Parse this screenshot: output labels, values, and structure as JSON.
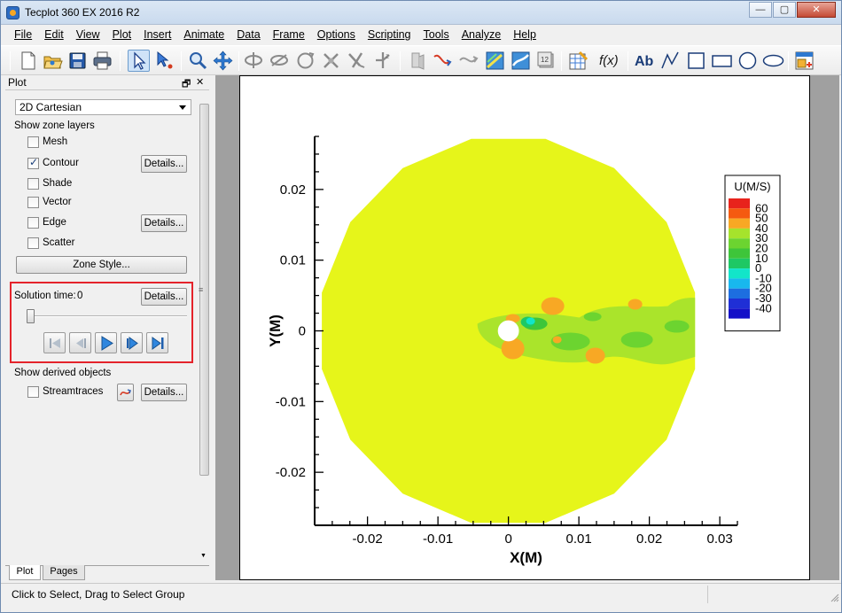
{
  "window": {
    "title": "Tecplot 360 EX 2016 R2",
    "controls": [
      "—",
      "▢",
      "✕"
    ]
  },
  "menu": [
    {
      "label": "File"
    },
    {
      "label": "Edit"
    },
    {
      "label": "View"
    },
    {
      "label": "Plot"
    },
    {
      "label": "Insert"
    },
    {
      "label": "Animate"
    },
    {
      "label": "Data"
    },
    {
      "label": "Frame"
    },
    {
      "label": "Options"
    },
    {
      "label": "Scripting"
    },
    {
      "label": "Tools"
    },
    {
      "label": "Analyze"
    },
    {
      "label": "Help"
    }
  ],
  "toolbar": {
    "icons": [
      "new-layout-icon",
      "open-icon",
      "save-icon",
      "print-icon",
      "selector-icon",
      "adjustor-icon",
      "zoom-icon",
      "translate-icon",
      "rotate-icons",
      "probe-icon",
      "slice-icon",
      "streamtrace-icon",
      "contour-level-icon",
      "isosurface-icon",
      "zone-edit-icon",
      "data-edit-icon",
      "equation-icon",
      "text-icon",
      "polyline-icon",
      "square-icon",
      "rectangle-icon",
      "circle-icon",
      "ellipse-icon",
      "frame-add-icon"
    ],
    "equation_label": "f(x)",
    "text_label": "Ab"
  },
  "sidebar": {
    "panel_title": "Plot",
    "plot_type": "2D Cartesian",
    "zone_layers_label": "Show zone layers",
    "layers": [
      {
        "label": "Mesh",
        "checked": false
      },
      {
        "label": "Contour",
        "checked": true,
        "details": "Details..."
      },
      {
        "label": "Shade",
        "checked": false
      },
      {
        "label": "Vector",
        "checked": false
      },
      {
        "label": "Edge",
        "checked": false,
        "details": "Details..."
      },
      {
        "label": "Scatter",
        "checked": false
      }
    ],
    "zone_style_button": "Zone Style...",
    "solution_time_label": "Solution time:",
    "solution_time_value": "0",
    "solution_details": "Details...",
    "derived_label": "Show derived objects",
    "streamtraces_label": "Streamtraces",
    "streamtraces_details": "Details...",
    "tabs": {
      "plot": "Plot",
      "pages": "Pages"
    }
  },
  "status": {
    "text": "Click to Select, Drag to Select Group"
  },
  "colors": {
    "background_field": "#e6f51a",
    "accent_highlight": "#e4232b"
  },
  "chart_data": {
    "type": "heatmap",
    "xlabel": "X(M)",
    "ylabel": "Y(M)",
    "xlim": [
      -0.0275,
      0.0325
    ],
    "ylim": [
      -0.0275,
      0.0275
    ],
    "x_ticks": [
      -0.02,
      -0.01,
      0,
      0.01,
      0.02,
      0.03
    ],
    "y_ticks": [
      0.02,
      0.01,
      0,
      -0.01,
      -0.02
    ],
    "x_tick_labels": [
      "-0.02",
      "-0.01",
      "0",
      "0.01",
      "0.02",
      "0.03"
    ],
    "y_tick_labels": [
      "0.02",
      "0.01",
      "0",
      "-0.01",
      "-0.02"
    ],
    "legend_title": "U(M/S)",
    "legend_placement": "right",
    "legend_levels": [
      {
        "label": "60",
        "color": "#e8231c"
      },
      {
        "label": "50",
        "color": "#f55a10"
      },
      {
        "label": "40",
        "color": "#f8a824"
      },
      {
        "label": "30",
        "color": "#a6e32c"
      },
      {
        "label": "20",
        "color": "#6cd430"
      },
      {
        "label": "10",
        "color": "#3ec53a"
      },
      {
        "label": "0",
        "color": "#1ec864"
      },
      {
        "label": "-10",
        "color": "#12e5c9"
      },
      {
        "label": "-20",
        "color": "#18b8ee"
      },
      {
        "label": "-30",
        "color": "#1d6ee0"
      },
      {
        "label": "-40",
        "color": "#1f2fd6"
      },
      {
        "label": "",
        "color": "#1410c8"
      }
    ],
    "domain_radius": 0.027,
    "cylinder_radius": 0.0015
  }
}
